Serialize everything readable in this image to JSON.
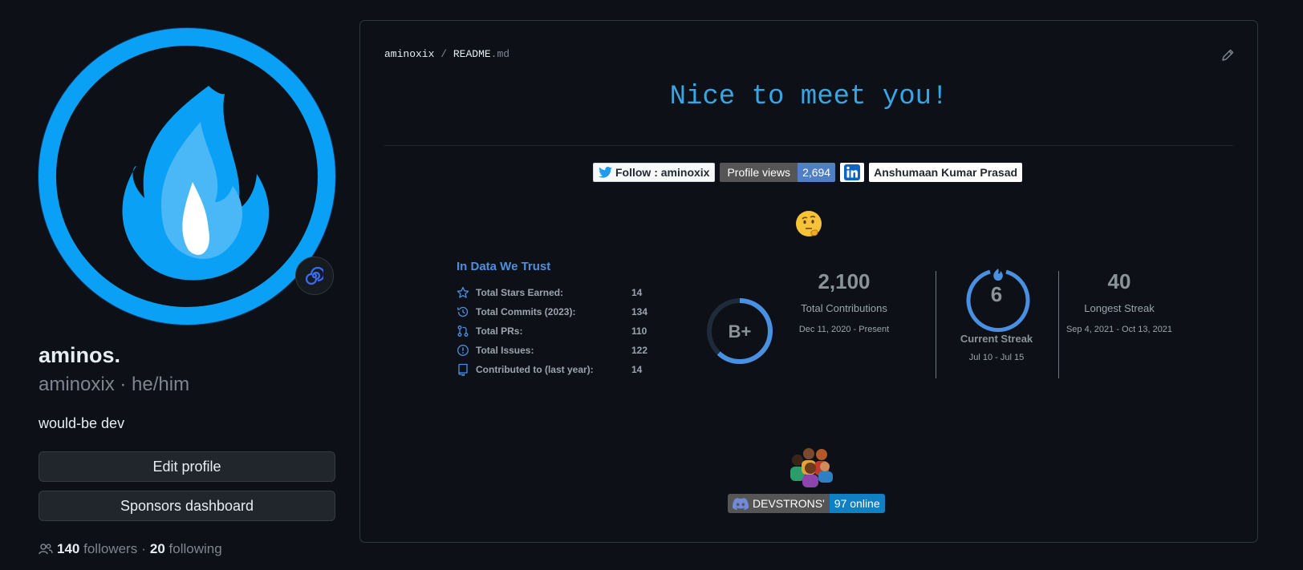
{
  "profile": {
    "name": "aminos.",
    "login_pronouns": "aminoxix · he/him",
    "bio": "would-be dev",
    "edit_label": "Edit profile",
    "sponsors_label": "Sponsors dashboard",
    "followers_count": "140",
    "followers_label": "followers",
    "separator": "·",
    "following_count": "20",
    "following_label": "following"
  },
  "readme": {
    "owner": "aminoxix",
    "slash": "/",
    "file_name": "README",
    "file_ext": ".md",
    "greeting": "Nice to meet you!"
  },
  "badges": {
    "twitter": "Follow : aminoxix",
    "views_label": "Profile views",
    "views_value": "2,694",
    "linkedin": "Anshumaan Kumar Prasad"
  },
  "stats": {
    "title": "In Data We Trust",
    "rows": [
      {
        "label": "Total Stars Earned:",
        "value": "14",
        "icon": "star-icon"
      },
      {
        "label": "Total Commits (2023):",
        "value": "134",
        "icon": "history-icon"
      },
      {
        "label": "Total PRs:",
        "value": "110",
        "icon": "pull-request-icon"
      },
      {
        "label": "Total Issues:",
        "value": "122",
        "icon": "issue-icon"
      },
      {
        "label": "Contributed to (last year):",
        "value": "14",
        "icon": "repo-icon"
      }
    ],
    "grade": "B+",
    "grade_progress": 0.62
  },
  "streak": {
    "total": "2,100",
    "total_label": "Total Contributions",
    "total_range": "Dec 11, 2020 - Present",
    "current": "6",
    "current_label": "Current Streak",
    "current_range": "Jul 10 - Jul 15",
    "longest": "40",
    "longest_label": "Longest Streak",
    "longest_range": "Sep 4, 2021 - Oct 13, 2021"
  },
  "discord": {
    "server": "DEVSTRONS'",
    "online": "97 online"
  },
  "colors": {
    "accent": "#36a6e6",
    "avatar_ring": "#0aa0f5",
    "stats_blue": "#4a90e2"
  }
}
